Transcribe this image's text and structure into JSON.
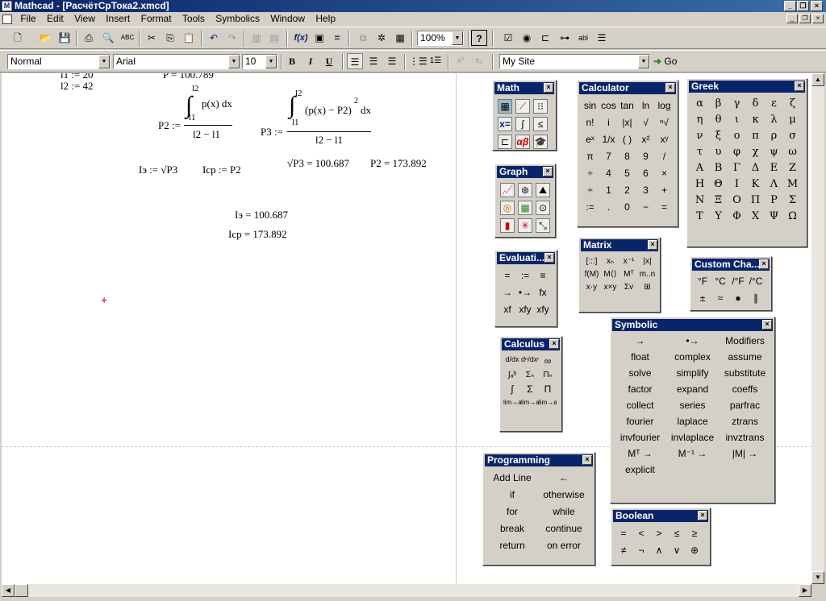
{
  "window": {
    "title": "Mathcad - [РасчётСрТока2.xmcd]",
    "app_icon": "mathcad-icon",
    "controls": [
      "_",
      "❐",
      "×"
    ]
  },
  "menu": [
    "File",
    "Edit",
    "View",
    "Insert",
    "Format",
    "Tools",
    "Symbolics",
    "Window",
    "Help"
  ],
  "standard_toolbar": {
    "zoom": "100%",
    "icons": [
      "new-icon",
      "open-icon",
      "save-icon",
      "print-icon",
      "print-preview-icon",
      "spellcheck-icon",
      "cut-icon",
      "copy-icon",
      "paste-icon",
      "undo-icon",
      "redo-icon",
      "align-icon",
      "function-icon",
      "unit-icon",
      "calculate-icon",
      "component-icon",
      "resource-icon",
      "help-icon"
    ]
  },
  "format_toolbar": {
    "style": "Normal",
    "font": "Arial",
    "size": "10",
    "bold": "B",
    "italic": "I",
    "underline": "U",
    "address": "My Site",
    "go": "Go"
  },
  "document": {
    "l1_def": "l1 := 20",
    "l2_def": "l2 := 42",
    "p_partial": "P = 100.789",
    "p2_lhs": "P2 :=",
    "p2_upper": "l2",
    "p2_integrand": "p(x) dx",
    "p2_lower": "l1",
    "p2_den": "l2 − l1",
    "p3_lhs": "P3 :=",
    "p3_upper": "l2",
    "p3_integrand": "(p(x) − P2)",
    "p3_exp": "2",
    "p3_dx": "dx",
    "p3_lower": "l1",
    "p3_den": "l2 − l1",
    "sqrt_p3_result": "√P3 = 100.687",
    "p2_result": "P2 = 173.892",
    "ie_def": "Iэ := √P3",
    "icp_def": "Icp := P2",
    "ie_result": "Iэ = 100.687",
    "icp_result": "Icp = 173.892",
    "cursor": "+"
  },
  "palettes": {
    "math": {
      "title": "Math",
      "icons": [
        "calculator-icon",
        "graph-icon",
        "matrix-icon",
        "evaluation-icon",
        "calculus-icon",
        "boolean-icon",
        "programming-icon",
        "greek-icon",
        "symbolic-icon"
      ]
    },
    "graph": {
      "title": "Graph",
      "icons": [
        "xy-plot-icon",
        "polar-plot-icon",
        "surface-plot-icon",
        "contour-plot-icon",
        "3d-bar-icon",
        "scatter-3d-icon",
        "vector-field-icon",
        "3d-plot-wizard-icon",
        "zoom-trace-icon"
      ]
    },
    "evaluation": {
      "title": "Evaluati...",
      "items": [
        "=",
        ":=",
        "≡",
        "→",
        "•→",
        "fx",
        "xf",
        "xfy",
        "xfy"
      ]
    },
    "calculus": {
      "title": "Calculus",
      "items": [
        "d/dx",
        "dⁿ/dxⁿ",
        "∞",
        "∫ₐᵇ",
        "Σₙ",
        "Πₙ",
        "∫",
        "Σ",
        "Π",
        "lim→a",
        "lim→a+",
        "lim→a−"
      ]
    },
    "calculator": {
      "title": "Calculator",
      "items": [
        "sin",
        "cos",
        "tan",
        "ln",
        "log",
        "n!",
        "i",
        "|x|",
        "√",
        "ⁿ√",
        "eˣ",
        "1/x",
        "( )",
        "x²",
        "xʸ",
        "π",
        "7",
        "8",
        "9",
        "/",
        "÷",
        "4",
        "5",
        "6",
        "×",
        "÷",
        "1",
        "2",
        "3",
        "+",
        ":=",
        ".",
        "0",
        "−",
        "="
      ]
    },
    "matrix": {
      "title": "Matrix",
      "items": [
        "[:::]",
        "xₙ",
        "x⁻¹",
        "|x|",
        "f(M)",
        "M⟨⟩",
        "Mᵀ",
        "m..n",
        "x·y",
        "x×y",
        "Σv",
        "⊞"
      ]
    },
    "greek": {
      "title": "Greek",
      "items": [
        "α",
        "β",
        "γ",
        "δ",
        "ε",
        "ζ",
        "η",
        "θ",
        "ι",
        "κ",
        "λ",
        "μ",
        "ν",
        "ξ",
        "ο",
        "π",
        "ρ",
        "σ",
        "τ",
        "υ",
        "φ",
        "χ",
        "ψ",
        "ω",
        "Α",
        "Β",
        "Γ",
        "Δ",
        "Ε",
        "Ζ",
        "Η",
        "Θ",
        "Ι",
        "Κ",
        "Λ",
        "Μ",
        "Ν",
        "Ξ",
        "Ο",
        "Π",
        "Ρ",
        "Σ",
        "Τ",
        "Υ",
        "Φ",
        "Χ",
        "Ψ",
        "Ω"
      ]
    },
    "custom": {
      "title": "Custom Cha...",
      "items": [
        "°F",
        "°C",
        "/°F",
        "/°C",
        "±",
        "≈",
        "●",
        "∥"
      ]
    },
    "symbolic": {
      "title": "Symbolic",
      "items": [
        "→",
        "•→",
        "Modifiers",
        "float",
        "complex",
        "assume",
        "solve",
        "simplify",
        "substitute",
        "factor",
        "expand",
        "coeffs",
        "collect",
        "series",
        "parfrac",
        "fourier",
        "laplace",
        "ztrans",
        "invfourier",
        "invlaplace",
        "invztrans",
        "Mᵀ →",
        "M⁻¹ →",
        "|M| →",
        "explicit"
      ]
    },
    "programming": {
      "title": "Programming",
      "items": [
        "Add Line",
        "←",
        "if",
        "otherwise",
        "for",
        "while",
        "break",
        "continue",
        "return",
        "on error"
      ]
    },
    "boolean": {
      "title": "Boolean",
      "items": [
        "=",
        "<",
        ">",
        "≤",
        "≥",
        "≠",
        "¬",
        "∧",
        "∨",
        "⊕"
      ]
    }
  }
}
